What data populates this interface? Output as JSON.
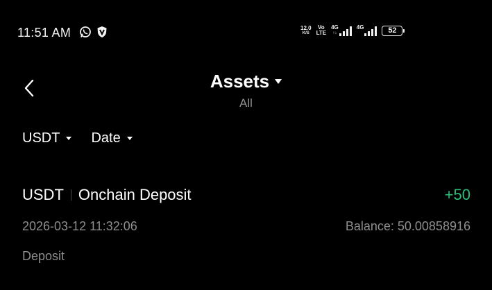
{
  "status_bar": {
    "time": "11:51 AM",
    "speed_value": "12.0",
    "speed_unit": "K/S",
    "volte_top": "Vo",
    "volte_bottom": "LTE",
    "network1": "4G",
    "network2": "4G",
    "battery": "52",
    "icons": [
      "whatsapp-icon",
      "vpn-icon",
      "signal-icon",
      "battery-icon"
    ]
  },
  "header": {
    "title": "Assets",
    "subtitle": "All",
    "back_icon": "chevron-left-icon"
  },
  "filters": [
    {
      "label": "USDT"
    },
    {
      "label": "Date"
    }
  ],
  "transactions": [
    {
      "asset": "USDT",
      "type_title": "Onchain Deposit",
      "amount": "+50",
      "datetime": "2026-03-12 11:32:06",
      "balance": "Balance: 50.00858916",
      "category": "Deposit"
    }
  ],
  "colors": {
    "background": "#000000",
    "text_primary": "#ffffff",
    "text_secondary": "#8e8e8e",
    "positive": "#2fbf7a"
  }
}
